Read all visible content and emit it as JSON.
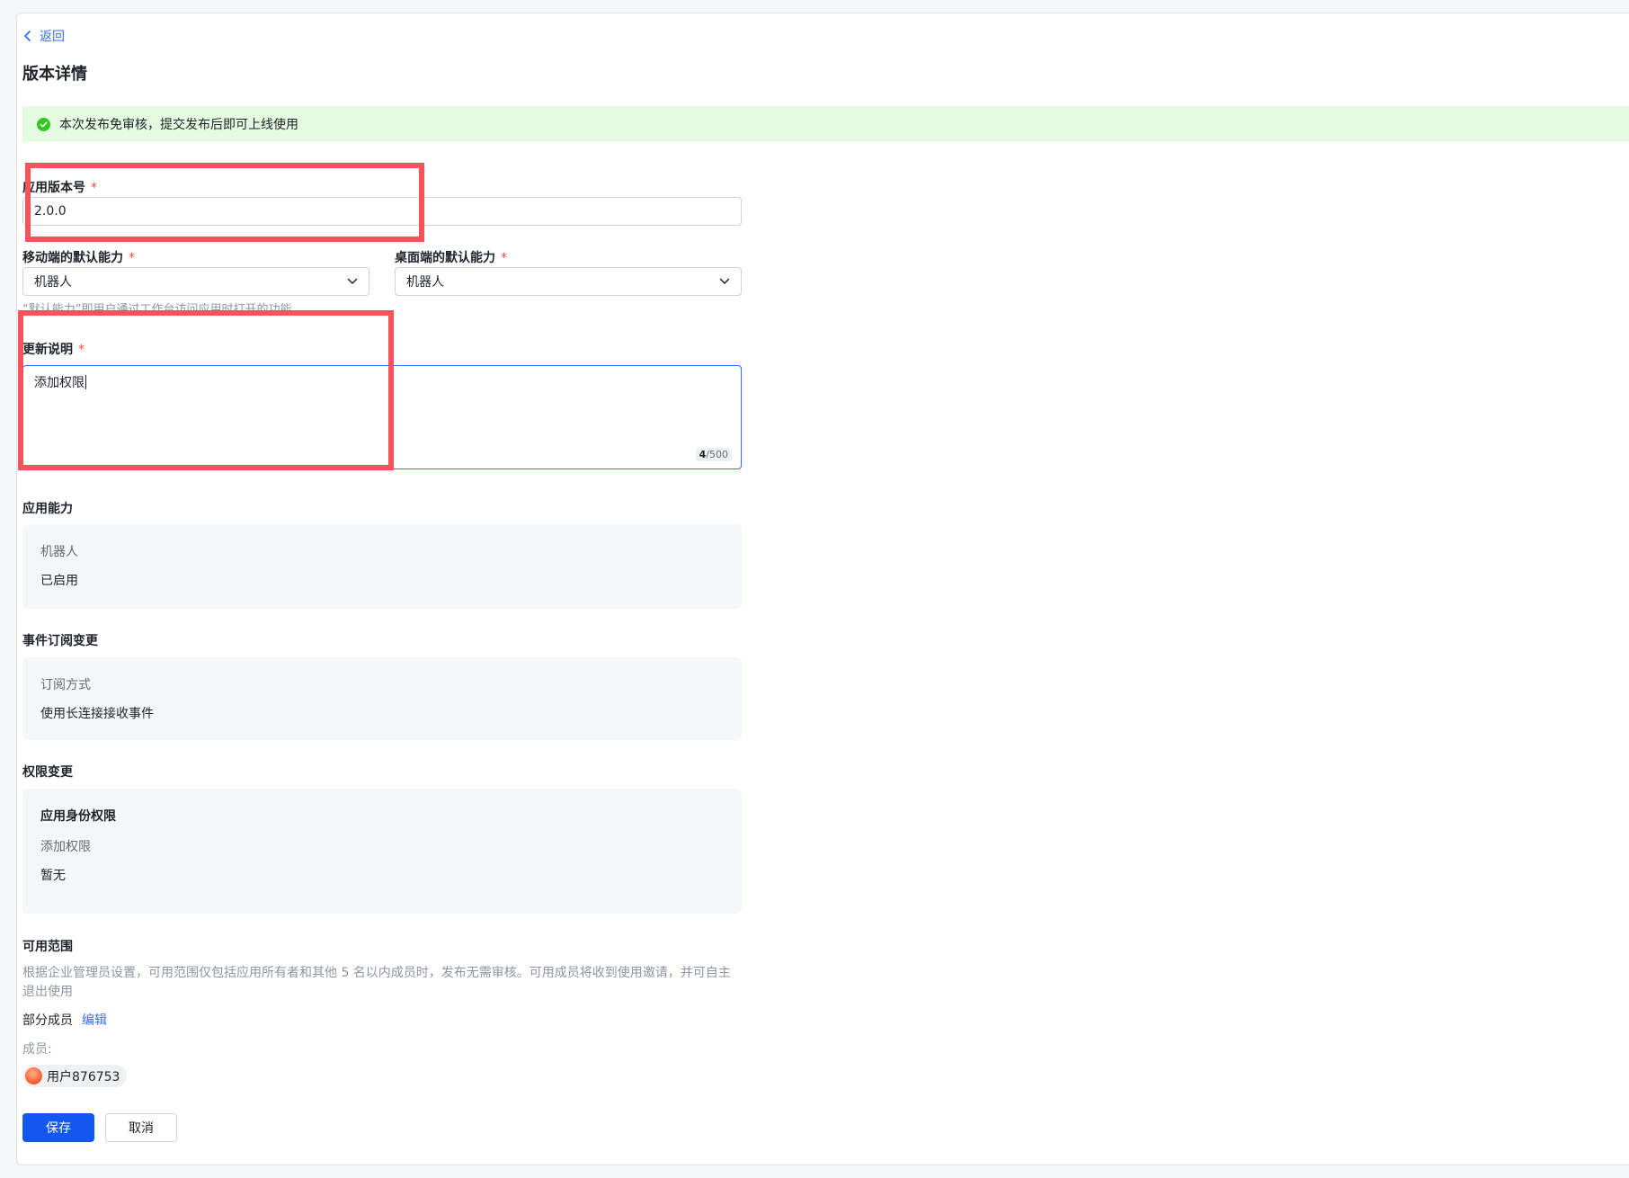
{
  "nav": {
    "back_label": "返回"
  },
  "page": {
    "title": "版本详情"
  },
  "alert": {
    "text": "本次发布免审核，提交发布后即可上线使用"
  },
  "version": {
    "label": "应用版本号",
    "required": "*",
    "value": "2.0.0"
  },
  "mobile_default": {
    "label": "移动端的默认能力",
    "required": "*",
    "value": "机器人"
  },
  "desktop_default": {
    "label": "桌面端的默认能力",
    "required": "*",
    "value": "机器人"
  },
  "default_hint": "“默认能力”即用户通过工作台访问应用时打开的功能",
  "update_notes": {
    "label": "更新说明",
    "required": "*",
    "value": "添加权限",
    "count": "4",
    "max": "/500"
  },
  "capabilities": {
    "title": "应用能力",
    "key": "机器人",
    "value": "已启用"
  },
  "events": {
    "title": "事件订阅变更",
    "key": "订阅方式",
    "value": "使用长连接接收事件"
  },
  "permissions": {
    "title": "权限变更",
    "heading": "应用身份权限",
    "key": "添加权限",
    "value": "暂无"
  },
  "scope": {
    "title": "可用范围",
    "description": "根据企业管理员设置，可用范围仅包括应用所有者和其他 5 名以内成员时，发布无需审核。可用成员将收到使用邀请，并可自主退出使用",
    "mode": "部分成员",
    "edit_label": "编辑",
    "members_label": "成员:",
    "members": [
      "用户876753"
    ]
  },
  "actions": {
    "save_label": "保存",
    "cancel_label": "取消"
  },
  "colors": {
    "accent": "#3370ff",
    "primary_button": "#1456f0",
    "success": "#34c724",
    "required": "#f54a45",
    "highlight": "#f5535b"
  }
}
